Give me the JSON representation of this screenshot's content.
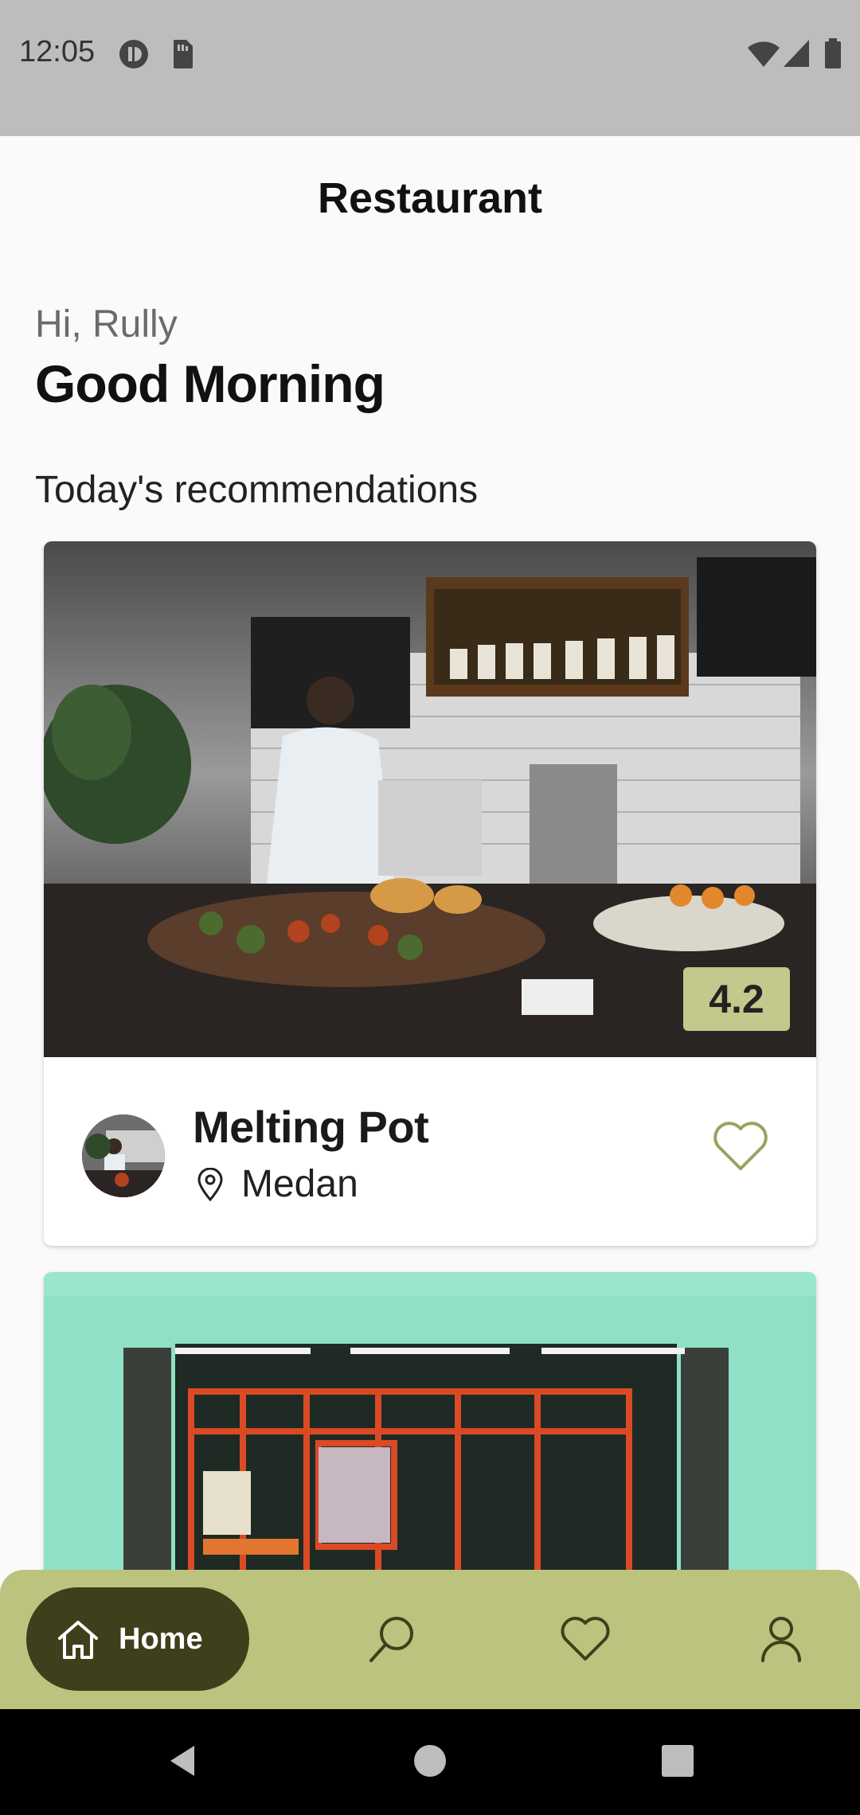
{
  "status_bar": {
    "time": "12:05",
    "icons": [
      "media-icon",
      "sim-icon",
      "wifi-icon",
      "signal-icon",
      "battery-icon"
    ]
  },
  "app_bar": {
    "title": "Restaurant"
  },
  "greeting": {
    "hello": "Hi, Rully",
    "headline": "Good Morning"
  },
  "section": {
    "title": "Today's recommendations"
  },
  "restaurants": [
    {
      "name": "Melting Pot",
      "city": "Medan",
      "rating": "4.2",
      "favorite": false
    },
    {
      "name": "",
      "city": "",
      "rating": ""
    }
  ],
  "bottom_nav": {
    "items": [
      {
        "label": "Home",
        "icon": "home-icon",
        "active": true
      },
      {
        "label": "",
        "icon": "search-icon"
      },
      {
        "label": "",
        "icon": "heart-icon"
      },
      {
        "label": "",
        "icon": "person-icon"
      }
    ]
  },
  "system_nav": {
    "icons": [
      "back-icon",
      "home-circle-icon",
      "recents-icon"
    ]
  },
  "colors": {
    "accent": "#bcc37f",
    "accent_dark": "#3f3f1c",
    "rating_bg": "#c3c98c",
    "status_bar": "#bdbdbd"
  }
}
